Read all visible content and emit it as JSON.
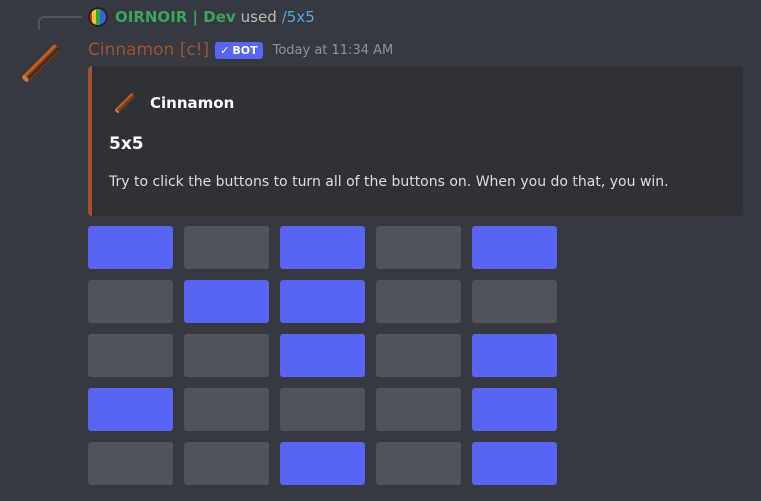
{
  "interaction": {
    "user": "OIRNOIR | Dev",
    "used_text": "used",
    "command": "/5x5"
  },
  "message": {
    "username": "Cinnamon [c!]",
    "bot_tag": "BOT",
    "timestamp": "Today at 11:34 AM",
    "avatar_icon": "cinnamon-stick-icon"
  },
  "embed": {
    "author": "Cinnamon",
    "title": "5x5",
    "description": "Try to click the buttons to turn all of the buttons on. When you do that, you win.",
    "accent_color": "#a0522d"
  },
  "colors": {
    "button_on": "#5865f2",
    "button_off": "#4f545c",
    "username": "#a0522d",
    "reply_user": "#3ba55d"
  },
  "board": [
    [
      true,
      false,
      true,
      false,
      true
    ],
    [
      false,
      true,
      true,
      false,
      false
    ],
    [
      false,
      false,
      true,
      false,
      true
    ],
    [
      true,
      false,
      false,
      false,
      true
    ],
    [
      false,
      false,
      true,
      false,
      true
    ]
  ]
}
